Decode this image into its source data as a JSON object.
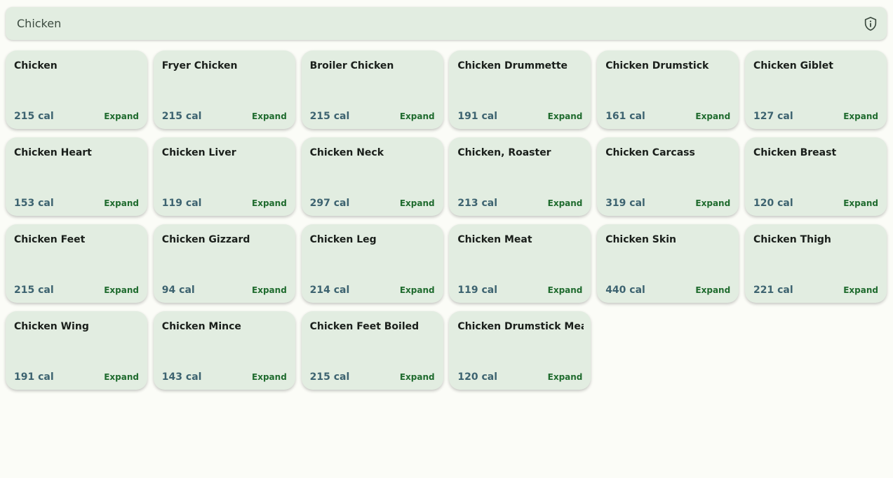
{
  "search": {
    "value": "Chicken",
    "icon": "shield-info-icon"
  },
  "expand_label": "Expand",
  "foods": [
    {
      "name": "Chicken",
      "calories": "215 cal"
    },
    {
      "name": "Fryer Chicken",
      "calories": "215 cal"
    },
    {
      "name": "Broiler Chicken",
      "calories": "215 cal"
    },
    {
      "name": "Chicken Drummette",
      "calories": "191 cal"
    },
    {
      "name": "Chicken Drumstick",
      "calories": "161 cal"
    },
    {
      "name": "Chicken Giblet",
      "calories": "127 cal"
    },
    {
      "name": "Chicken Heart",
      "calories": "153 cal"
    },
    {
      "name": "Chicken Liver",
      "calories": "119 cal"
    },
    {
      "name": "Chicken Neck",
      "calories": "297 cal"
    },
    {
      "name": "Chicken, Roaster",
      "calories": "213 cal"
    },
    {
      "name": "Chicken Carcass",
      "calories": "319 cal"
    },
    {
      "name": "Chicken Breast",
      "calories": "120 cal"
    },
    {
      "name": "Chicken Feet",
      "calories": "215 cal"
    },
    {
      "name": "Chicken Gizzard",
      "calories": "94 cal"
    },
    {
      "name": "Chicken Leg",
      "calories": "214 cal"
    },
    {
      "name": "Chicken Meat",
      "calories": "119 cal"
    },
    {
      "name": "Chicken Skin",
      "calories": "440 cal"
    },
    {
      "name": "Chicken Thigh",
      "calories": "221 cal"
    },
    {
      "name": "Chicken Wing",
      "calories": "191 cal"
    },
    {
      "name": "Chicken Mince",
      "calories": "143 cal"
    },
    {
      "name": "Chicken Feet Boiled",
      "calories": "215 cal"
    },
    {
      "name": "Chicken Drumstick Meat",
      "calories": "120 cal"
    }
  ],
  "colors": {
    "background": "#fbfcf7",
    "card": "#e2ede1",
    "calories_text": "#3d6370",
    "expand_text": "#1f6b2e"
  }
}
